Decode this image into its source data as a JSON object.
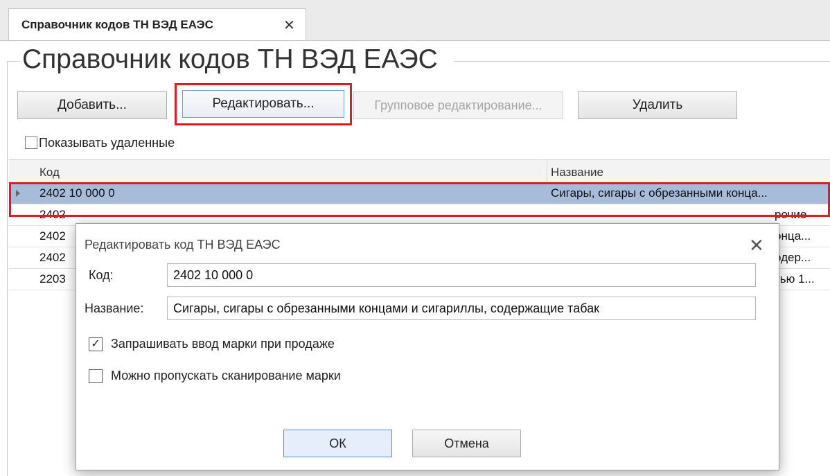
{
  "tab": {
    "label": "Справочник кодов ТН ВЭД ЕАЭС",
    "close_glyph": "✕"
  },
  "page": {
    "title": "Справочник кодов ТН ВЭД ЕАЭС"
  },
  "toolbar": {
    "add_label": "Добавить...",
    "edit_label": "Редактировать...",
    "group_edit_label": "Групповое редактирование...",
    "delete_label": "Удалить"
  },
  "show_deleted": {
    "label": "Показывать удаленные",
    "checked": false
  },
  "grid": {
    "columns": [
      "Код",
      "Название"
    ],
    "rows": [
      {
        "code": "2402 10 000 0",
        "name": "Сигары, сигары с обрезанными конца...",
        "selected": true
      },
      {
        "code": "2402",
        "name": "рочие",
        "selected": false
      },
      {
        "code": "2402",
        "name": "онца...",
        "selected": false
      },
      {
        "code": "2402",
        "name": "одер...",
        "selected": false
      },
      {
        "code": "2203",
        "name": "тью 1...",
        "selected": false
      }
    ]
  },
  "dialog": {
    "title": "Редактировать код ТН ВЭД ЕАЭС",
    "close_glyph": "✕",
    "code_label": "Код:",
    "code_value": "2402 10 000 0",
    "name_label": "Название:",
    "name_value": "Сигары, сигары с обрезанными концами и сигариллы, содержащие табак",
    "require_mark": {
      "label": "Запрашивать ввод марки при продаже",
      "checked": true,
      "glyph": "✓"
    },
    "skip_scan": {
      "label": "Можно пропускать сканирование марки",
      "checked": false
    },
    "ok_label": "ОК",
    "cancel_label": "Отмена"
  },
  "colors": {
    "highlight": "#e01b24",
    "selected_row": "#a7bcd9"
  }
}
